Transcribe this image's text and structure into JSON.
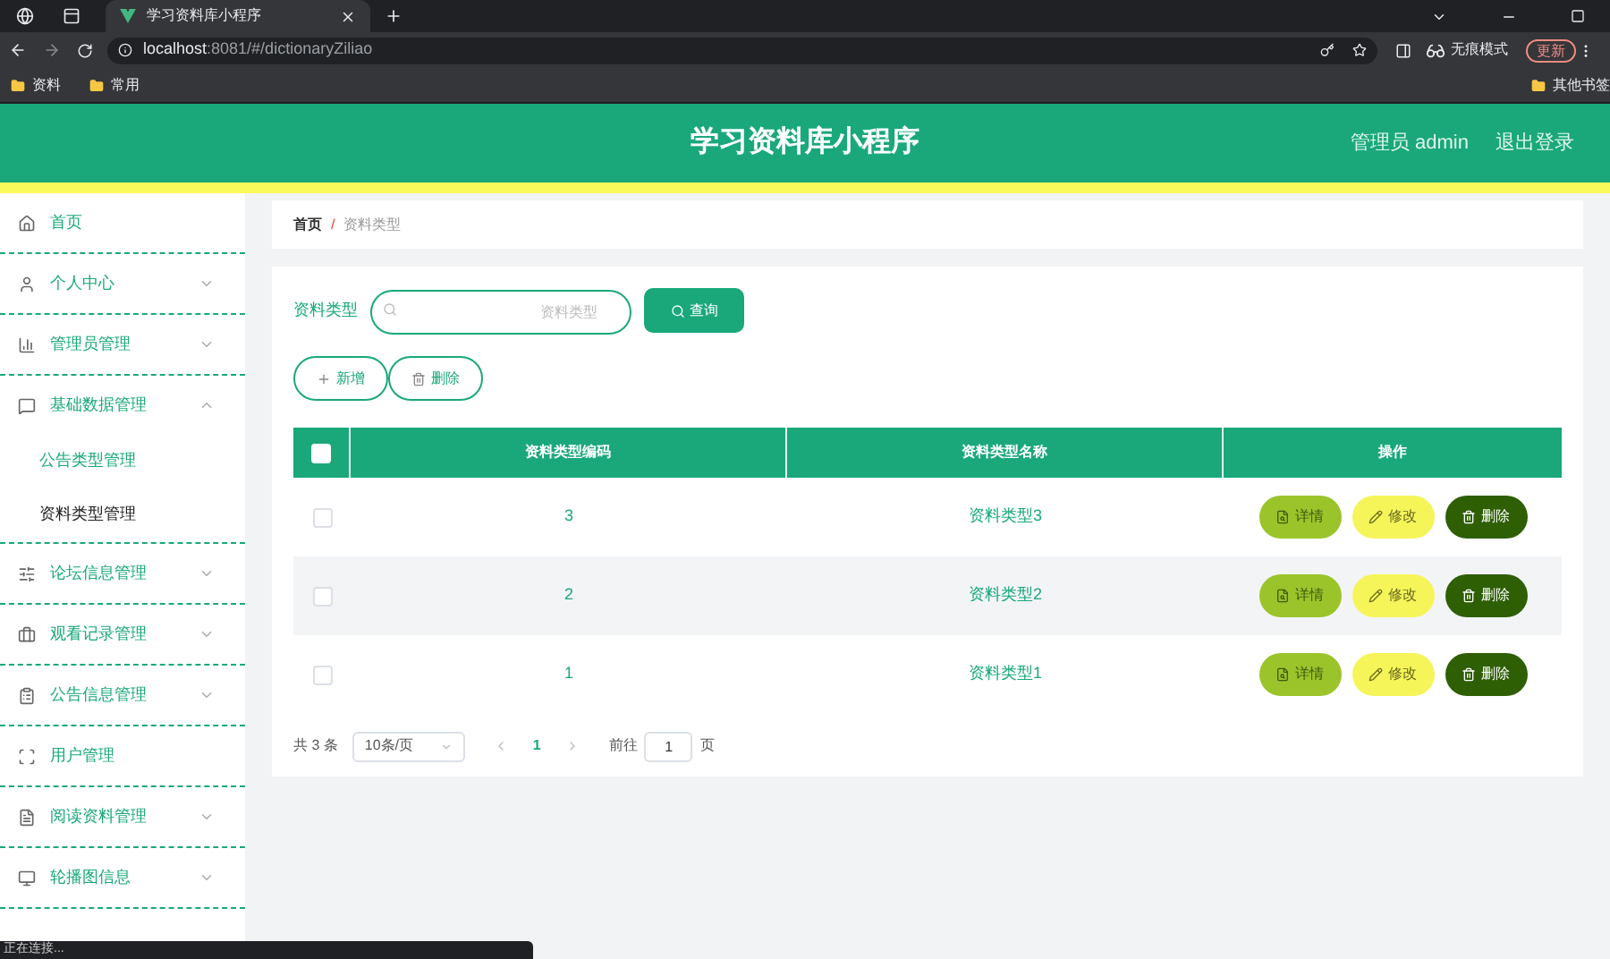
{
  "browser": {
    "tab_title": "学习资料库小程序",
    "url_host": "localhost",
    "url_rest": ":8081/#/dictionaryZiliao",
    "profile": "无痕模式",
    "update": "更新",
    "bookmarks": [
      "资料",
      "常用"
    ],
    "other_bookmarks": "其他书签",
    "status": "正在连接..."
  },
  "header": {
    "title": "学习资料库小程序",
    "user": "管理员 admin",
    "logout": "退出登录"
  },
  "sidebar": {
    "items": [
      {
        "label": "首页",
        "kind": "home"
      },
      {
        "label": "个人中心",
        "kind": "user",
        "expanded": false
      },
      {
        "label": "管理员管理",
        "kind": "chart",
        "expanded": false
      },
      {
        "label": "基础数据管理",
        "kind": "chat",
        "expanded": true,
        "children": [
          {
            "label": "公告类型管理",
            "selected": false
          },
          {
            "label": "资料类型管理",
            "selected": true
          }
        ]
      },
      {
        "label": "论坛信息管理",
        "kind": "sliders",
        "expanded": false
      },
      {
        "label": "观看记录管理",
        "kind": "briefcase",
        "expanded": false
      },
      {
        "label": "公告信息管理",
        "kind": "clipboard",
        "expanded": false
      },
      {
        "label": "用户管理",
        "kind": "frame"
      },
      {
        "label": "阅读资料管理",
        "kind": "file",
        "expanded": false
      },
      {
        "label": "轮播图信息",
        "kind": "monitor",
        "expanded": false
      }
    ]
  },
  "breadcrumb": {
    "items": [
      "首页",
      "资料类型"
    ],
    "separator": "/"
  },
  "search": {
    "label": "资料类型",
    "placeholder": "资料类型",
    "button": "查询"
  },
  "actions": [
    "新增",
    "删除"
  ],
  "table": {
    "columns": [
      "资料类型编码",
      "资料类型名称",
      "操作"
    ],
    "header_checked": false,
    "rows": [
      {
        "checked": false,
        "code": "3",
        "name": "资料类型3",
        "buttons": [
          {
            "kind": "detail",
            "label": "详情"
          },
          {
            "kind": "edit",
            "label": "修改"
          },
          {
            "kind": "delete",
            "label": "删除"
          }
        ]
      },
      {
        "checked": false,
        "code": "2",
        "name": "资料类型2",
        "buttons": [
          {
            "kind": "detail",
            "label": "详情"
          },
          {
            "kind": "edit",
            "label": "修改"
          },
          {
            "kind": "delete",
            "label": "删除"
          }
        ]
      },
      {
        "checked": false,
        "code": "1",
        "name": "资料类型1",
        "buttons": [
          {
            "kind": "detail",
            "label": "详情"
          },
          {
            "kind": "edit",
            "label": "修改"
          },
          {
            "kind": "delete",
            "label": "删除"
          }
        ]
      }
    ]
  },
  "pagination": {
    "total": "共 3 条",
    "page_size": "10条/页",
    "pages": [
      {
        "label": "1",
        "selected": true
      }
    ],
    "goto": "前往",
    "goto_value": "1",
    "page_unit": "页"
  }
}
